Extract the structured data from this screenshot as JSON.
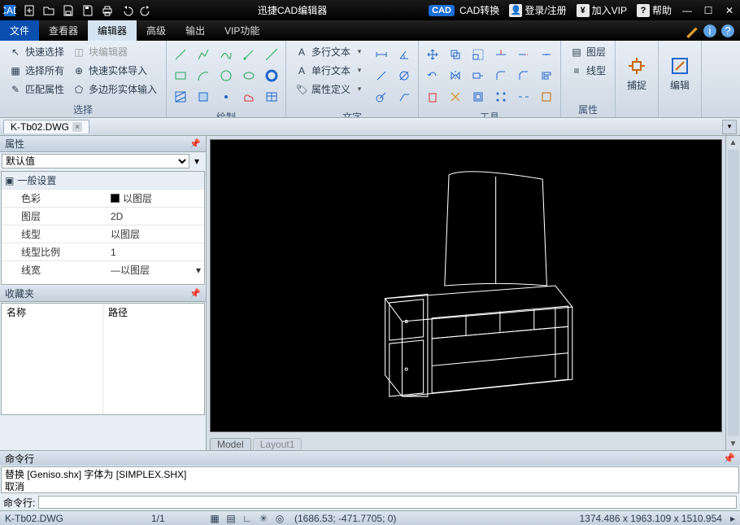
{
  "titlebar": {
    "app_title": "迅捷CAD编辑器",
    "cad_tag": "CAD",
    "cad_convert": "CAD转换",
    "login": "登录/注册",
    "vip": "加入VIP",
    "help": "帮助"
  },
  "menu": {
    "file": "文件",
    "tabs": [
      "查看器",
      "编辑器",
      "高级",
      "输出",
      "VIP功能"
    ],
    "active_index": 1
  },
  "ribbon": {
    "groups": {
      "select": {
        "label": "选择",
        "quick_select": "快速选择",
        "block_edit": "块编辑器",
        "select_all": "选择所有",
        "quick_solid_import": "快速实体导入",
        "match_prop": "匹配属性",
        "polygon_solid_input": "多边形实体输入"
      },
      "draw": {
        "label": "绘制"
      },
      "text": {
        "label": "文字",
        "mtext": "多行文本",
        "stext": "单行文本",
        "attdef": "属性定义"
      },
      "tools": {
        "label": "工具"
      },
      "props": {
        "label": "属性",
        "layer": "图层",
        "linetype": "线型"
      },
      "capture": {
        "label": "捕捉"
      },
      "edit": {
        "label": "编辑"
      }
    }
  },
  "doc_tab": {
    "name": "K-Tb02.DWG"
  },
  "prop_panel": {
    "title": "属性",
    "selector": "默认值",
    "cat_general": "一般设置",
    "rows": {
      "color": {
        "k": "色彩",
        "v": "以图层"
      },
      "layer": {
        "k": "图层",
        "v": "2D"
      },
      "ltype": {
        "k": "线型",
        "v": "以图层"
      },
      "lscale": {
        "k": "线型比例",
        "v": "1"
      },
      "lweight": {
        "k": "线宽",
        "v": "—以图层"
      }
    }
  },
  "fav_panel": {
    "title": "收藏夹",
    "col_name": "名称",
    "col_path": "路径"
  },
  "canvas_tabs": {
    "model": "Model",
    "layout": "Layout1"
  },
  "cmd": {
    "title": "命令行",
    "log1": "替换 [Geniso.shx] 字体为 [SIMPLEX.SHX]",
    "log2": "取消",
    "prompt": "命令行:"
  },
  "status": {
    "file": "K-Tb02.DWG",
    "page": "1/1",
    "coord": "(1686.53; -471.7705; 0)",
    "dims": "1374.486 x 1963.109 x 1510.954",
    "arr": "▸"
  }
}
